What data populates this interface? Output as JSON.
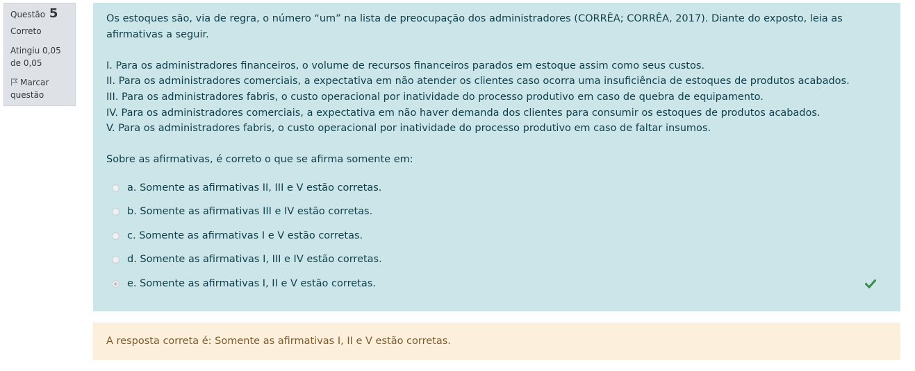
{
  "info": {
    "question_label": "Questão",
    "question_number": "5",
    "state": "Correto",
    "grade": "Atingiu 0,05 de 0,05",
    "flag_label": "Marcar questão",
    "flag_icon": "flag-outline-icon"
  },
  "question": {
    "intro_line1": "Os estoques são, via de regra, o número “um” na lista de preocupação dos administradores (CORRÊA; CORRÊA, 2017). Diante do exposto, leia as",
    "intro_line2": "afirmativas a seguir.",
    "statements": [
      "I. Para os administradores financeiros, o volume de recursos financeiros parados em estoque assim como seus custos.",
      "II. Para os administradores comerciais, a expectativa em não atender os clientes caso ocorra uma insuficiência de estoques de produtos acabados.",
      "III. Para os administradores fabris, o custo operacional por inatividade do processo produtivo em caso de quebra de equipamento.",
      "IV. Para os administradores comerciais, a expectativa em não haver demanda dos clientes para consumir os estoques de produtos acabados.",
      "V. Para os administradores fabris, o custo operacional por inatividade do processo produtivo em caso de faltar insumos."
    ],
    "prompt": "Sobre as afirmativas, é correto o que se afirma somente em:"
  },
  "answers": [
    {
      "text": "a. Somente as afirmativas II, III e V estão corretas.",
      "selected": false
    },
    {
      "text": "b. Somente as afirmativas III e IV estão corretas.",
      "selected": false
    },
    {
      "text": "c. Somente as afirmativas I e V estão corretas.",
      "selected": false
    },
    {
      "text": "d. Somente as afirmativas I, III e IV estão corretas.",
      "selected": false
    },
    {
      "text": "e. Somente as afirmativas I, II e V estão corretas.",
      "selected": true,
      "icon": "checkmark-icon"
    }
  ],
  "feedback": {
    "right_answer": "A resposta correta é: Somente as afirmativas I, II e V estão corretas."
  },
  "colors": {
    "info_bg": "#dee2e6",
    "formulation_bg": "#cce5e9",
    "feedback_bg": "#fcefdc",
    "correct_check": "#3a8a4a"
  }
}
